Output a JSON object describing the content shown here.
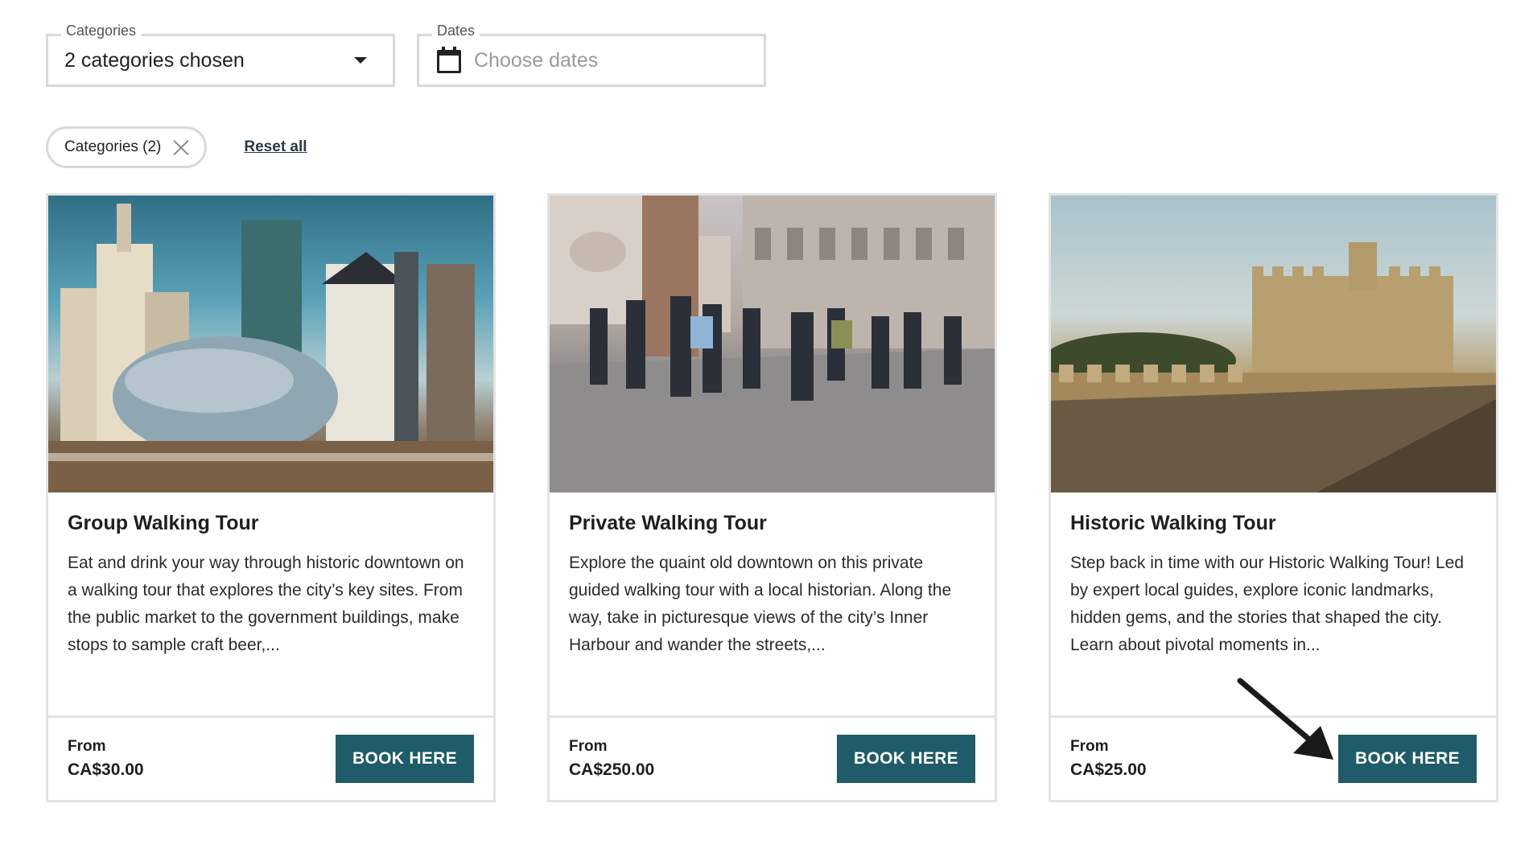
{
  "filters": {
    "categories": {
      "legend": "Categories",
      "value": "2 categories chosen"
    },
    "dates": {
      "legend": "Dates",
      "placeholder": "Choose dates"
    }
  },
  "chips": {
    "categories_chip": "Categories (2)",
    "reset_label": "Reset all"
  },
  "cards": [
    {
      "title": "Group Walking Tour",
      "description": "Eat and drink your way through historic downtown on a walking tour that explores the city’s key sites. From the public market to the government buildings, make stops to sample craft beer,...",
      "from_label": "From",
      "price": "CA$30.00",
      "button": "BOOK HERE"
    },
    {
      "title": "Private Walking Tour",
      "description": "Explore the quaint old downtown on this private guided walking tour with a local historian. Along the way, take in picturesque views of the city’s Inner Harbour and wander the streets,...",
      "from_label": "From",
      "price": "CA$250.00",
      "button": "BOOK HERE"
    },
    {
      "title": "Historic Walking Tour",
      "description": "Step back in time with our Historic Walking Tour! Led by expert local guides, explore iconic landmarks, hidden gems, and the stories that shaped the city. Learn about pivotal moments in...",
      "from_label": "From",
      "price": "CA$25.00",
      "button": "BOOK HERE"
    }
  ],
  "colors": {
    "button": "#1f5b68",
    "border": "#d9d9d9"
  },
  "icons": [
    "caret-down-icon",
    "calendar-icon",
    "close-icon",
    "arrow-pointer-icon"
  ]
}
